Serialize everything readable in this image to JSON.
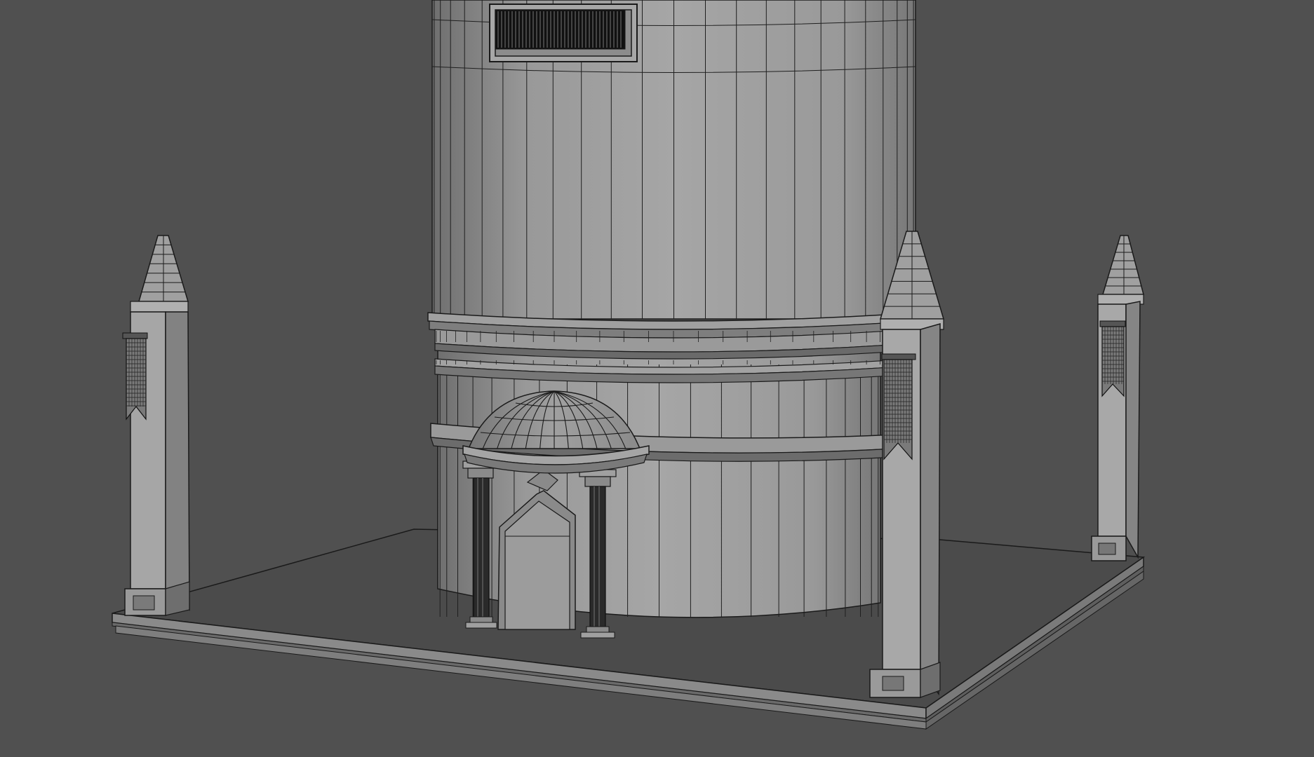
{
  "viewport": {
    "background": "#505050",
    "render_style": "wireframe-on-shaded",
    "wire_color": "#1a1a1a",
    "surface_light": "#a9a9a9",
    "surface_mid": "#8f8f8f",
    "surface_dark": "#6e6e6e"
  },
  "scene": {
    "objects": [
      "cylindrical-tower",
      "tower-vent-window",
      "tower-moulding-rings",
      "domed-portico",
      "portico-column-left",
      "portico-column-right",
      "arched-door",
      "base-platform",
      "corner-pillar-front-left",
      "corner-pillar-front-right",
      "corner-pillar-back-right",
      "hanging-banners"
    ]
  }
}
